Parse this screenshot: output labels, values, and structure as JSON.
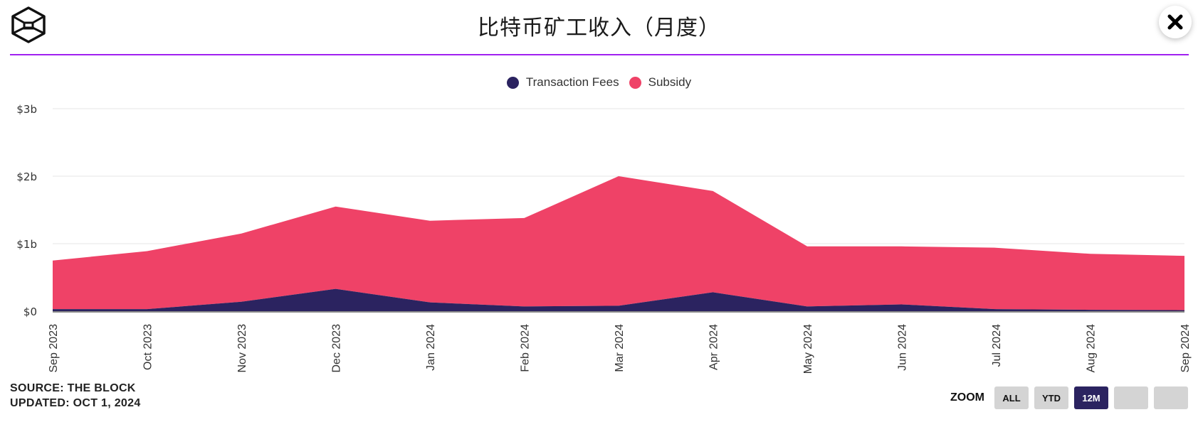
{
  "header": {
    "title": "比特币矿工收入（月度）",
    "logo": "the-block-cube-logo",
    "close_icon": "close-x-icon",
    "rule_color": "#a020f0"
  },
  "legend": [
    {
      "label": "Transaction Fees",
      "color": "#2b2360"
    },
    {
      "label": "Subsidy",
      "color": "#ef4267"
    }
  ],
  "footer": {
    "source": "SOURCE: THE BLOCK",
    "updated": "UPDATED: OCT 1, 2024"
  },
  "zoom": {
    "label": "ZOOM",
    "buttons": [
      {
        "label": "ALL",
        "active": false
      },
      {
        "label": "YTD",
        "active": false
      },
      {
        "label": "12M",
        "active": true
      },
      {
        "label": "",
        "active": false
      },
      {
        "label": "",
        "active": false
      }
    ]
  },
  "chart_data": {
    "type": "area",
    "stacked": true,
    "title": "比特币矿工收入（月度）",
    "xlabel": "",
    "ylabel": "",
    "categories": [
      "Sep 2023",
      "Oct 2023",
      "Nov 2023",
      "Dec 2023",
      "Jan 2024",
      "Feb 2024",
      "Mar 2024",
      "Apr 2024",
      "May 2024",
      "Jun 2024",
      "Jul 2024",
      "Aug 2024",
      "Sep 2024"
    ],
    "series": [
      {
        "name": "Transaction Fees",
        "color": "#2b2360",
        "values": [
          0.03,
          0.03,
          0.14,
          0.33,
          0.13,
          0.07,
          0.08,
          0.28,
          0.07,
          0.1,
          0.03,
          0.02,
          0.015
        ]
      },
      {
        "name": "Subsidy",
        "color": "#ef4267",
        "values": [
          0.72,
          0.86,
          1.01,
          1.22,
          1.21,
          1.31,
          1.92,
          1.5,
          0.89,
          0.86,
          0.91,
          0.83,
          0.805
        ]
      }
    ],
    "units": "billion USD",
    "ylim": [
      0,
      3
    ],
    "yticks": [
      0,
      1,
      2,
      3
    ],
    "ytick_labels": [
      "$0",
      "$1b",
      "$2b",
      "$3b"
    ],
    "grid": true,
    "legend_position": "top-center"
  }
}
